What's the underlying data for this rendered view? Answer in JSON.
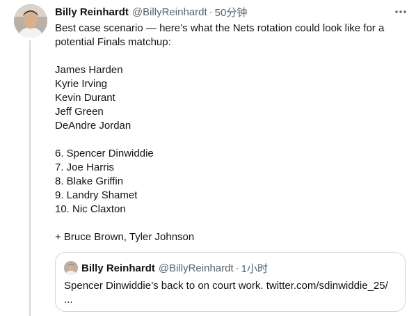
{
  "tweet": {
    "author_name": "Billy Reinhardt",
    "author_handle": "@BillyReinhardt",
    "separator": "·",
    "timestamp": "50分钟",
    "more_icon": "ellipsis-icon",
    "lines": [
      "Best case scenario — here’s what the Nets rotation could look like for a",
      "potential Finals matchup:",
      "",
      "James Harden",
      "Kyrie Irving",
      "Kevin Durant",
      "Jeff Green",
      "DeAndre Jordan",
      "",
      "6. Spencer Dinwiddie",
      "7. Joe Harris",
      "8. Blake Griffin",
      "9. Landry Shamet",
      "10. Nic Claxton",
      "",
      "+ Bruce Brown, Tyler Johnson"
    ]
  },
  "quoted_tweet": {
    "author_name": "Billy Reinhardt",
    "author_handle": "@BillyReinhardt",
    "separator": "·",
    "timestamp": "1小时",
    "text_line1": "Spencer Dinwiddie’s back to on court work. twitter.com/sdinwiddie_25/",
    "text_line2": "..."
  },
  "colors": {
    "text_primary": "#0f1419",
    "text_secondary": "#536471",
    "border": "#cfd9de"
  }
}
